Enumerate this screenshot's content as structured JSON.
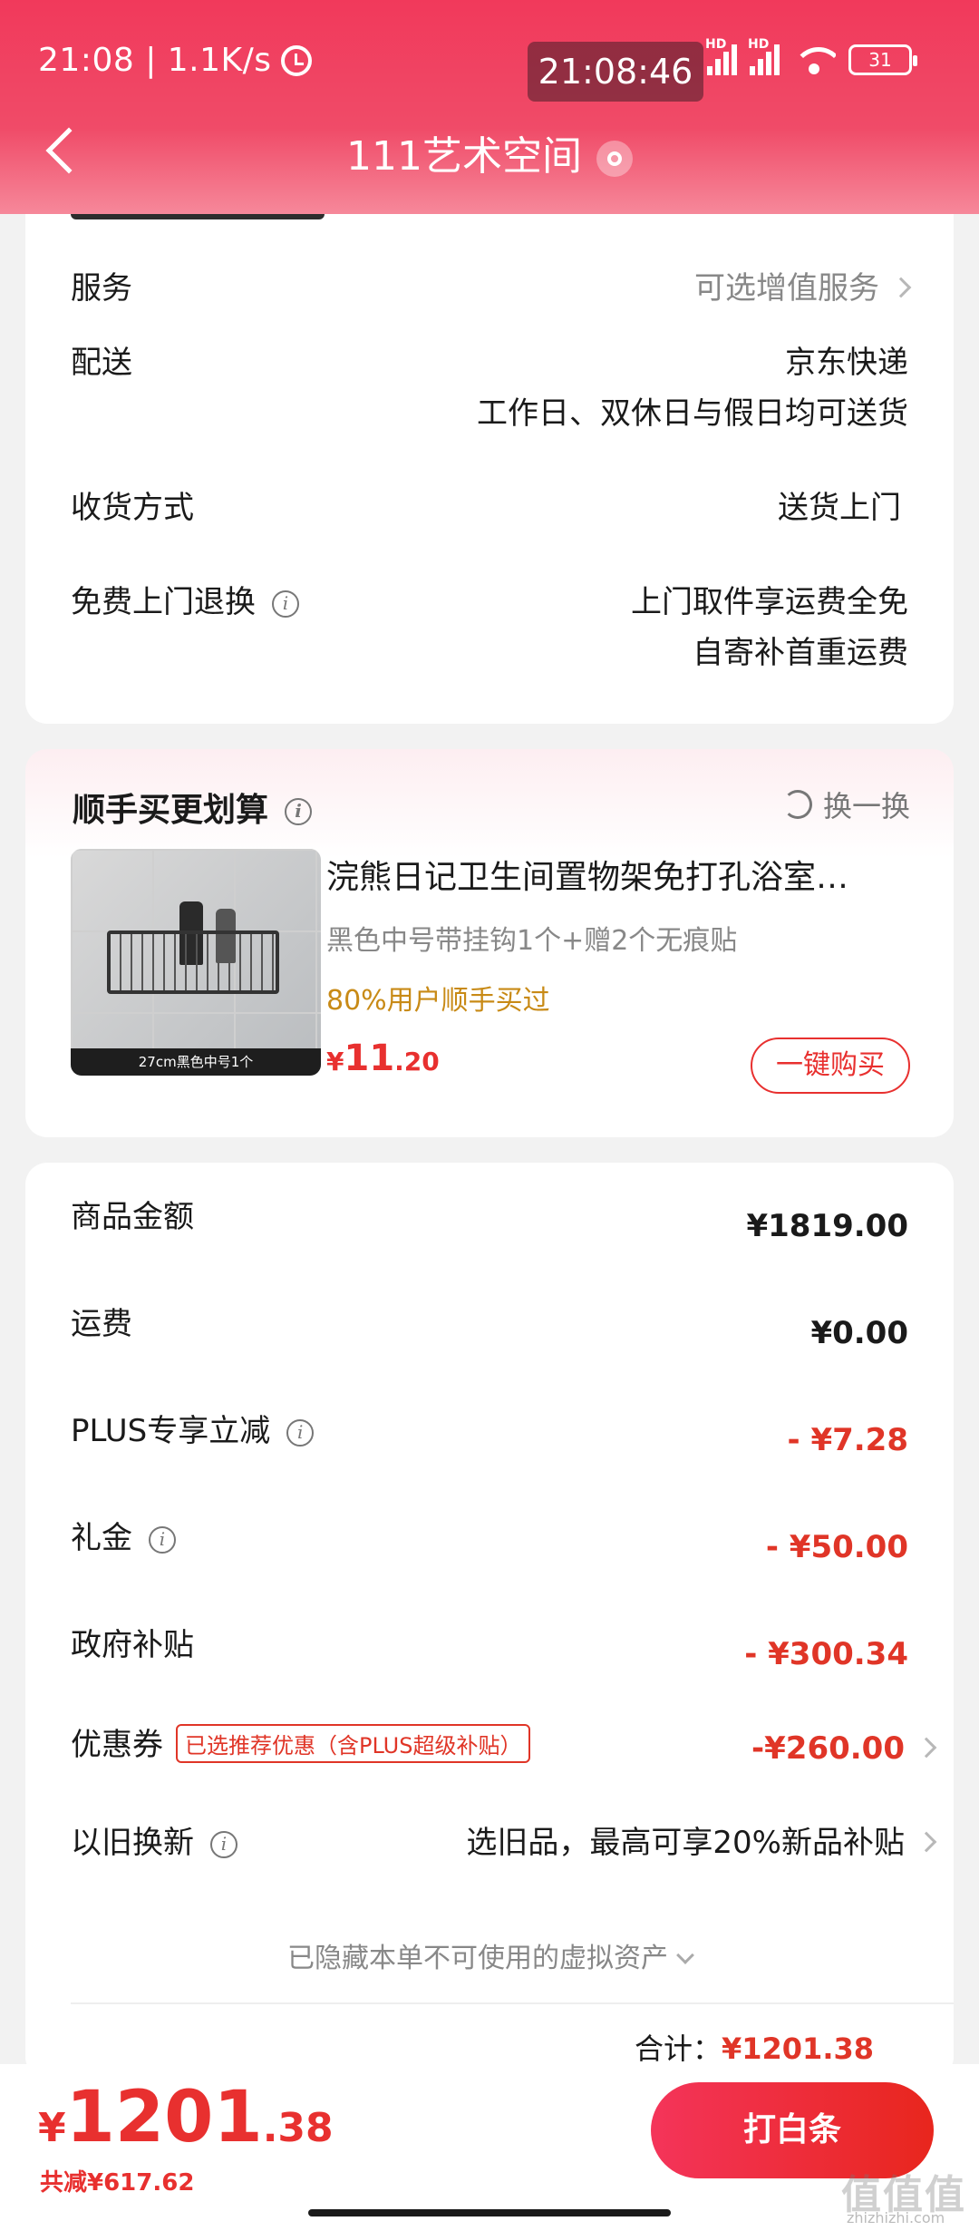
{
  "status_bar": {
    "time_speed": "21:08 | 1.1K/s",
    "clock": "21:08:46",
    "signal_label": "HD",
    "battery": "31"
  },
  "nav": {
    "title": "111艺术空间"
  },
  "delivery": {
    "service_label": "服务",
    "service_value": "可选增值服务",
    "shipping_label": "配送",
    "shipping_value_1": "京东快递",
    "shipping_value_2": "工作日、双休日与假日均可送货",
    "receive_label": "收货方式",
    "receive_value": "送货上门",
    "return_label": "免费上门退换",
    "return_value_1": "上门取件享运费全免",
    "return_value_2": "自寄补首重运费"
  },
  "recommend": {
    "title": "顺手买更划算",
    "swap": "换一换",
    "product_name": "浣熊日记卫生间置物架免打孔浴室…",
    "spec": "黑色中号带挂钩1个+赠2个无痕贴",
    "social": "80%用户顺手买过",
    "price_yen": "¥",
    "price_int": "11",
    "price_dec": ".20",
    "image_caption": "27cm黑色中号1个",
    "buy_button": "一键购买"
  },
  "breakdown": {
    "goods_label": "商品金额",
    "goods_value": "¥1819.00",
    "freight_label": "运费",
    "freight_value": "¥0.00",
    "plus_label": "PLUS专享立减",
    "plus_value": "- ¥7.28",
    "gift_label": "礼金",
    "gift_value": "- ¥50.00",
    "subsidy_label": "政府补贴",
    "subsidy_value": "- ¥300.34",
    "coupon_label": "优惠券",
    "coupon_tag": "已选推荐优惠（含PLUS超级补贴）",
    "coupon_value": "-¥260.00",
    "tradein_label": "以旧换新",
    "tradein_value": "选旧品，最高可享20%新品补贴",
    "hidden_note": "已隐藏本单不可使用的虚拟资产",
    "total_label": "合计：",
    "total_value": "¥1201.38"
  },
  "bottom": {
    "yen": "¥",
    "price_int": "1201",
    "price_dec": ".38",
    "saved": "共减¥617.62",
    "pay_button": "打白条",
    "watermark": "值值值",
    "watermark_sub": "zhizhizhi.com"
  },
  "colors": {
    "accent": "#e8302f",
    "header": "#f1395b",
    "social": "#c88a16"
  }
}
